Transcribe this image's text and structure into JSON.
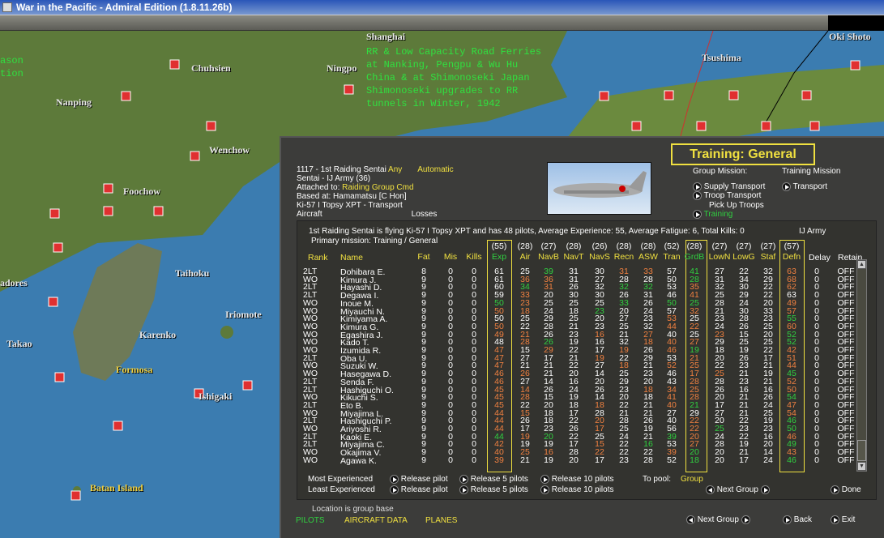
{
  "window": {
    "title": "War in the Pacific - Admiral Edition (1.8.11.26b)"
  },
  "map": {
    "labels": [
      "Shanghai",
      "Chuhsien",
      "Ningpo",
      "Nanping",
      "Wenchow",
      "Foochow",
      "Taihoku",
      "Iriomote",
      "Karenko",
      "Takao",
      "Ishigaki",
      "Tsushima",
      "Oki Shoto",
      "ason",
      "tion",
      "adores"
    ],
    "yellow_labels": [
      "Formosa",
      "Batan Island"
    ],
    "note": "RR & Low Capacity Road Ferries\nat Nanking, Pengpu & Wu Hu\nChina & at Shimonoseki Japan\nShimonoseki upgrades to RR\ntunnels in Winter, 1942"
  },
  "group": {
    "line1_id": "1117 - 1st Raiding Sentai",
    "line1_any": "Any",
    "line1_auto": "Automatic",
    "line2": "Sentai - IJ Army (36)",
    "attached_label": "Attached to:",
    "attached_value": "Raiding Group Cmd",
    "based": "Based at:  Hamamatsu [C Hon]",
    "aircraft": "Ki-57 I Topsy XPT - Transport",
    "aircraft_hdr": "Aircraft",
    "losses_hdr": "Losses"
  },
  "mission": {
    "title": "Training: General",
    "group_mission_label": "Group Mission:",
    "group_mission_value": "Training Mission",
    "options": [
      "Supply Transport",
      "Transport",
      "Troop Transport",
      "Pick Up Troops",
      "Training"
    ]
  },
  "summary": {
    "text": "1st Raiding Sentai is flying Ki-57 I Topsy XPT and has 48 pilots,  Average Experience: 55, Average Fatigue: 6, Total Kills: 0",
    "service": "IJ Army",
    "primary": "Primary mission: Training / General"
  },
  "table": {
    "columns": [
      "Rank",
      "Name",
      "Fat",
      "Mis",
      "Kills",
      "Exp",
      "Air",
      "NavB",
      "NavT",
      "NavS",
      "Recn",
      "ASW",
      "Tran",
      "GrdB",
      "LowN",
      "LowG",
      "Staf",
      "Defn",
      "Delay",
      "Retain"
    ],
    "averages": [
      "(55)",
      "(28)",
      "(27)",
      "(28)",
      "(26)",
      "(28)",
      "(28)",
      "(52)",
      "(28)",
      "(27)",
      "(27)",
      "(27)",
      "(57)"
    ],
    "colors": {
      "w": "#ffffff",
      "o": "#f08040",
      "g": "#30d040"
    },
    "rows": [
      {
        "rank": "2LT",
        "name": "Dohibara E.",
        "fat": 8,
        "mis": 0,
        "kills": 0,
        "skills": [
          61,
          25,
          39,
          31,
          30,
          31,
          33,
          57,
          41,
          27,
          22,
          32,
          63
        ],
        "c": "wwgwwoowgwwwo",
        "delay": 0,
        "retain": "OFF"
      },
      {
        "rank": "WO",
        "name": "Kimura J.",
        "fat": 9,
        "mis": 0,
        "kills": 0,
        "skills": [
          61,
          36,
          36,
          31,
          27,
          28,
          28,
          50,
          28,
          31,
          34,
          29,
          68
        ],
        "c": "woowwwwwgwwwo",
        "delay": 0,
        "retain": "OFF"
      },
      {
        "rank": "2LT",
        "name": "Hayashi D.",
        "fat": 9,
        "mis": 0,
        "kills": 0,
        "skills": [
          60,
          34,
          31,
          26,
          32,
          32,
          32,
          53,
          35,
          32,
          30,
          22,
          62
        ],
        "c": "wgowwggwowwwo",
        "delay": 0,
        "retain": "OFF"
      },
      {
        "rank": "2LT",
        "name": "Degawa I.",
        "fat": 9,
        "mis": 0,
        "kills": 0,
        "skills": [
          59,
          33,
          20,
          30,
          30,
          26,
          31,
          46,
          41,
          25,
          29,
          22,
          63
        ],
        "c": "wowwwwwwowwww",
        "delay": 0,
        "retain": "OFF"
      },
      {
        "rank": "WO",
        "name": "Inoue M.",
        "fat": 9,
        "mis": 0,
        "kills": 0,
        "skills": [
          50,
          23,
          25,
          25,
          25,
          33,
          26,
          50,
          25,
          28,
          24,
          20,
          49
        ],
        "c": "gowwwgwggwwwo",
        "delay": 0,
        "retain": "OFF"
      },
      {
        "rank": "WO",
        "name": "Miyauchi N.",
        "fat": 9,
        "mis": 0,
        "kills": 0,
        "skills": [
          50,
          18,
          24,
          18,
          23,
          20,
          24,
          57,
          32,
          21,
          30,
          33,
          57
        ],
        "c": "oowwgwwwowwwo",
        "delay": 0,
        "retain": "OFF"
      },
      {
        "rank": "WO",
        "name": "Kimiyama A.",
        "fat": 9,
        "mis": 0,
        "kills": 0,
        "skills": [
          50,
          25,
          29,
          25,
          20,
          27,
          23,
          53,
          25,
          23,
          28,
          23,
          55
        ],
        "c": "wwwwwwwowwwwg",
        "delay": 0,
        "retain": "OFF"
      },
      {
        "rank": "WO",
        "name": "Kimura G.",
        "fat": 9,
        "mis": 0,
        "kills": 0,
        "skills": [
          50,
          22,
          28,
          21,
          23,
          25,
          32,
          44,
          22,
          24,
          26,
          25,
          60
        ],
        "c": "owwwwwwoowwwo",
        "delay": 0,
        "retain": "OFF"
      },
      {
        "rank": "WO",
        "name": "Egashira J.",
        "fat": 9,
        "mis": 0,
        "kills": 0,
        "skills": [
          49,
          21,
          26,
          23,
          16,
          21,
          27,
          40,
          25,
          23,
          15,
          20,
          52
        ],
        "c": "oowwowowwowwg",
        "delay": 0,
        "retain": "OFF"
      },
      {
        "rank": "WO",
        "name": "Kado T.",
        "fat": 9,
        "mis": 0,
        "kills": 0,
        "skills": [
          48,
          28,
          26,
          19,
          16,
          32,
          18,
          40,
          27,
          29,
          25,
          25,
          52
        ],
        "c": "wogwwwooowwwg",
        "delay": 0,
        "retain": "OFF"
      },
      {
        "rank": "WO",
        "name": "Izumida R.",
        "fat": 9,
        "mis": 0,
        "kills": 0,
        "skills": [
          47,
          15,
          29,
          22,
          17,
          19,
          26,
          46,
          19,
          18,
          19,
          22,
          42
        ],
        "c": "owowwowogwwwo",
        "delay": 0,
        "retain": "OFF"
      },
      {
        "rank": "2LT",
        "name": "Oba U.",
        "fat": 9,
        "mis": 0,
        "kills": 0,
        "skills": [
          47,
          27,
          17,
          21,
          19,
          22,
          29,
          53,
          21,
          20,
          26,
          17,
          51
        ],
        "c": "owwwowwwowwwo",
        "delay": 0,
        "retain": "OFF"
      },
      {
        "rank": "WO",
        "name": "Suzuki W.",
        "fat": 9,
        "mis": 0,
        "kills": 0,
        "skills": [
          47,
          21,
          21,
          22,
          27,
          18,
          21,
          52,
          25,
          22,
          23,
          21,
          44
        ],
        "c": "owwwwowoowwwo",
        "delay": 0,
        "retain": "OFF"
      },
      {
        "rank": "WO",
        "name": "Hasegawa D.",
        "fat": 9,
        "mis": 0,
        "kills": 0,
        "skills": [
          46,
          26,
          21,
          20,
          14,
          25,
          23,
          46,
          17,
          25,
          21,
          19,
          45
        ],
        "c": "oowwwwwwoowwg",
        "delay": 0,
        "retain": "OFF"
      },
      {
        "rank": "2LT",
        "name": "Senda F.",
        "fat": 9,
        "mis": 0,
        "kills": 0,
        "skills": [
          46,
          27,
          14,
          16,
          20,
          29,
          20,
          43,
          28,
          28,
          23,
          21,
          52
        ],
        "c": "owwwwwwwowwwo",
        "delay": 0,
        "retain": "OFF"
      },
      {
        "rank": "2LT",
        "name": "Hashiguchi O.",
        "fat": 9,
        "mis": 0,
        "kills": 0,
        "skills": [
          45,
          14,
          26,
          24,
          26,
          23,
          18,
          34,
          25,
          26,
          16,
          16,
          50
        ],
        "c": "oowwwwooowwwo",
        "delay": 0,
        "retain": "OFF"
      },
      {
        "rank": "WO",
        "name": "Kikuchi S.",
        "fat": 9,
        "mis": 0,
        "kills": 0,
        "skills": [
          45,
          28,
          15,
          19,
          14,
          20,
          18,
          41,
          28,
          20,
          21,
          26,
          54
        ],
        "c": "oowwwwwoowwwg",
        "delay": 0,
        "retain": "OFF"
      },
      {
        "rank": "2LT",
        "name": "Eto B.",
        "fat": 9,
        "mis": 0,
        "kills": 0,
        "skills": [
          45,
          22,
          20,
          18,
          18,
          22,
          21,
          40,
          21,
          17,
          21,
          24,
          47
        ],
        "c": "owwwowwogwwwo",
        "delay": 0,
        "retain": "OFF"
      },
      {
        "rank": "WO",
        "name": "Miyajima L.",
        "fat": 9,
        "mis": 0,
        "kills": 0,
        "skills": [
          44,
          15,
          18,
          17,
          28,
          21,
          21,
          27,
          29,
          27,
          21,
          25,
          54
        ],
        "c": "oowwwwwwwwwwo",
        "delay": 0,
        "retain": "OFF"
      },
      {
        "rank": "2LT",
        "name": "Hashiguchi P.",
        "fat": 9,
        "mis": 0,
        "kills": 0,
        "skills": [
          44,
          26,
          18,
          22,
          20,
          28,
          26,
          40,
          22,
          20,
          22,
          19,
          46
        ],
        "c": "owwwowwwowwwg",
        "delay": 0,
        "retain": "OFF"
      },
      {
        "rank": "WO",
        "name": "Ariyoshi R.",
        "fat": 9,
        "mis": 0,
        "kills": 0,
        "skills": [
          44,
          17,
          23,
          26,
          17,
          25,
          19,
          56,
          22,
          25,
          23,
          23,
          50
        ],
        "c": "owwwowwwogwwg",
        "delay": 0,
        "retain": "OFF"
      },
      {
        "rank": "2LT",
        "name": "Kaoki E.",
        "fat": 9,
        "mis": 0,
        "kills": 0,
        "skills": [
          44,
          19,
          20,
          22,
          25,
          24,
          21,
          39,
          20,
          24,
          22,
          16,
          46
        ],
        "c": "gogwwwwgowwwo",
        "delay": 0,
        "retain": "OFF"
      },
      {
        "rank": "2LT",
        "name": "Miyajima C.",
        "fat": 9,
        "mis": 0,
        "kills": 0,
        "skills": [
          42,
          19,
          19,
          17,
          15,
          22,
          16,
          53,
          27,
          28,
          19,
          20,
          49
        ],
        "c": "owwwowgwowwwg",
        "delay": 0,
        "retain": "OFF"
      },
      {
        "rank": "WO",
        "name": "Okajima V.",
        "fat": 9,
        "mis": 0,
        "kills": 0,
        "skills": [
          40,
          25,
          16,
          28,
          22,
          22,
          22,
          39,
          20,
          20,
          21,
          14,
          43
        ],
        "c": "ooowowwogwwwo",
        "delay": 0,
        "retain": "OFF"
      },
      {
        "rank": "WO",
        "name": "Agawa K.",
        "fat": 9,
        "mis": 0,
        "kills": 0,
        "skills": [
          39,
          21,
          19,
          20,
          17,
          23,
          28,
          52,
          18,
          20,
          17,
          24,
          46
        ],
        "c": "owwwwwwwgwwwg",
        "delay": 0,
        "retain": "OFF"
      }
    ]
  },
  "release": {
    "most": "Most Experienced",
    "least": "Least Experienced",
    "release1": "Release pilot",
    "release5": "Release 5 pilots",
    "release10": "Release 10 pilots",
    "to_pool_label": "To pool:",
    "to_pool_value": "Group",
    "next_group": "Next Group",
    "done": "Done"
  },
  "footer": {
    "location": "Location is group base",
    "tabs": [
      "PILOTS",
      "AIRCRAFT DATA",
      "PLANES"
    ],
    "next_group": "Next Group",
    "back": "Back",
    "exit": "Exit"
  }
}
